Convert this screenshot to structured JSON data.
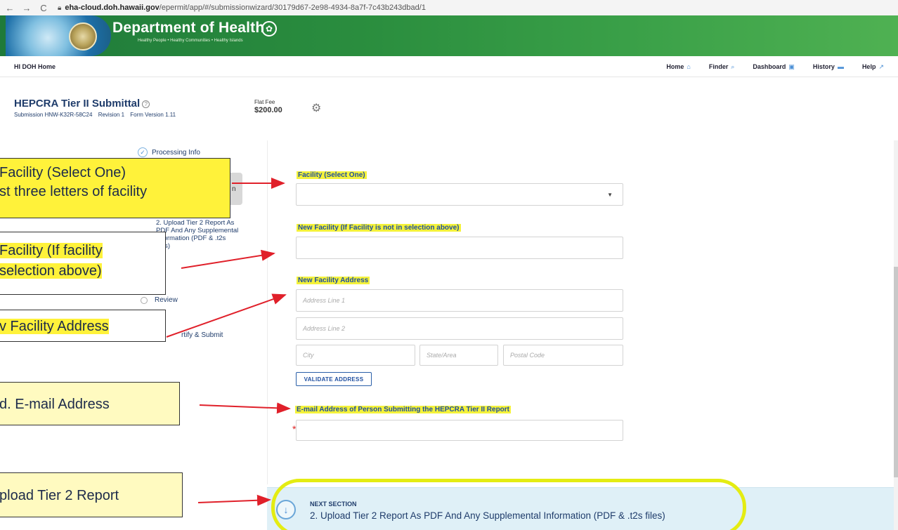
{
  "browser": {
    "back": "←",
    "forward": "→",
    "reload": "C",
    "url_host": "eha-cloud.doh.hawaii.gov",
    "url_path": "/epermit/app/#/submissionwizard/30179d67-2e98-4934-8a7f-7c43b243dbad/1"
  },
  "banner": {
    "title": "Department of Health",
    "subtitle": "Healthy People • Healthy Communities • Healthy Islands"
  },
  "nav": {
    "home_link": "HI DOH Home",
    "items": [
      {
        "label": "Home",
        "icon": "home-icon",
        "glyph": "⌂"
      },
      {
        "label": "Finder",
        "icon": "search-icon",
        "glyph": "⌕"
      },
      {
        "label": "Dashboard",
        "icon": "dashboard-icon",
        "glyph": "▣"
      },
      {
        "label": "History",
        "icon": "history-icon",
        "glyph": "▬"
      },
      {
        "label": "Help",
        "icon": "external-link-icon",
        "glyph": "↗"
      }
    ]
  },
  "header": {
    "title": "HEPCRA Tier II Submittal",
    "submission": "Submission HNW-K32R-58C24",
    "revision": "Revision 1",
    "form_version": "Form Version 1.11",
    "fee_label": "Flat Fee",
    "fee_value": "$200.00"
  },
  "steps": {
    "processing": "Processing Info",
    "active_fragment": "n",
    "upload": "2. Upload Tier 2 Report As PDF And Any Supplemental Information (PDF & .t2s files)",
    "review": "Review",
    "certify": "rtify & Submit"
  },
  "form": {
    "facility_label": "Facility (Select One)",
    "new_facility_label": "New Facility (If Facility is not in selection above)",
    "new_facility_address_label": "New Facility Address",
    "address_line1_placeholder": "Address Line 1",
    "address_line2_placeholder": "Address Line 2",
    "city_placeholder": "City",
    "state_placeholder": "State/Area",
    "postal_placeholder": "Postal Code",
    "validate_button": "VALIDATE ADDRESS",
    "email_label": "E-mail Address of Person Submitting the HEPCRA Tier II Report",
    "required_mark": "*"
  },
  "next_section": {
    "heading": "NEXT SECTION",
    "title": "2. Upload Tier 2 Report As PDF And Any Supplemental Information (PDF & .t2s files)"
  },
  "annotations": {
    "c1_line1": "Facility (Select One)",
    "c1_line2": "st three letters of facility",
    "c2_line1": "Facility (If facility",
    "c2_line2": "selection above)",
    "c3": "v Facility Address",
    "c4": "d.   E-mail Address",
    "c5": "pload Tier 2 Report"
  },
  "colors": {
    "highlight": "#fff23a",
    "arrow": "#e0202a",
    "banner_green": "#2a8d3e",
    "label_blue": "#1f4fa0"
  }
}
